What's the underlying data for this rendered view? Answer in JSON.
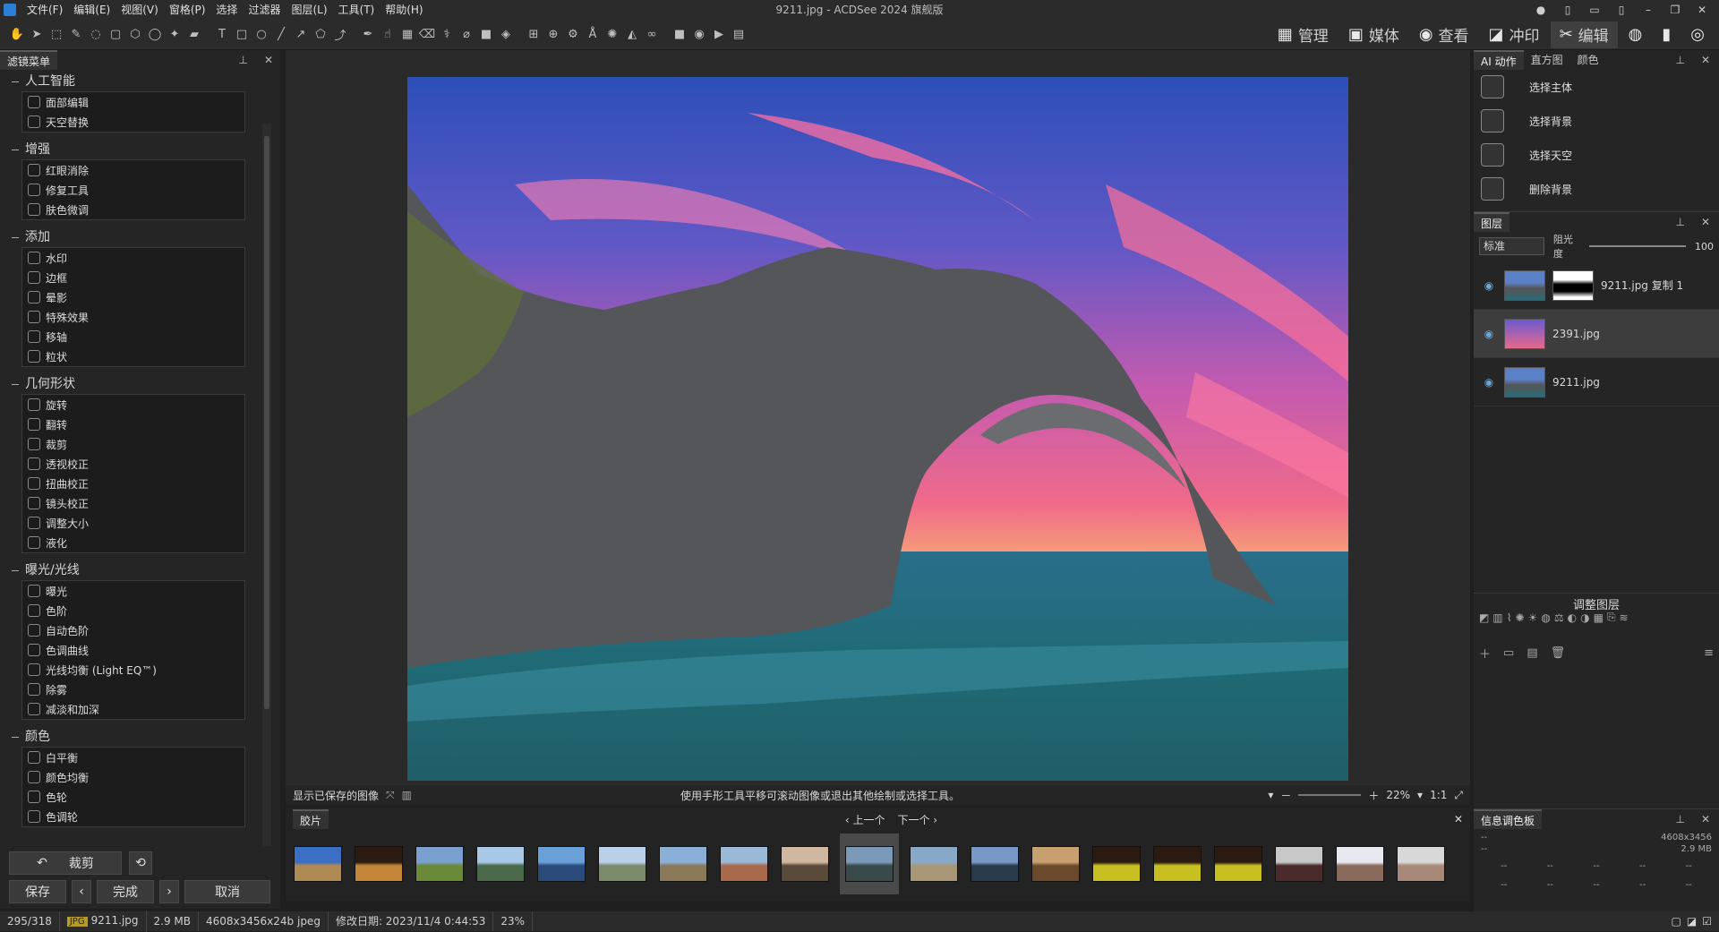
{
  "window": {
    "title": "9211.jpg - ACDSee 2024 旗舰版",
    "menu": [
      "文件(F)",
      "编辑(E)",
      "视图(V)",
      "窗格(P)",
      "选择",
      "过滤器",
      "图层(L)",
      "工具(T)",
      "帮助(H)"
    ]
  },
  "modes": [
    {
      "label": "管理",
      "icon": "grid-icon"
    },
    {
      "label": "媒体",
      "icon": "media-icon"
    },
    {
      "label": "查看",
      "icon": "eye-icon"
    },
    {
      "label": "冲印",
      "icon": "develop-icon"
    },
    {
      "label": "编辑",
      "icon": "edit-icon",
      "active": true
    }
  ],
  "left_panel": {
    "tab": "滤镜菜单",
    "sections": [
      {
        "title": "人工智能",
        "items": [
          "面部编辑",
          "天空替换"
        ]
      },
      {
        "title": "增强",
        "items": [
          "红眼消除",
          "修复工具",
          "肤色微调"
        ]
      },
      {
        "title": "添加",
        "items": [
          "水印",
          "边框",
          "晕影",
          "特殊效果",
          "移轴",
          "粒状"
        ]
      },
      {
        "title": "几何形状",
        "items": [
          "旋转",
          "翻转",
          "裁剪",
          "透视校正",
          "扭曲校正",
          "镜头校正",
          "调整大小",
          "液化"
        ]
      },
      {
        "title": "曝光/光线",
        "items": [
          "曝光",
          "色阶",
          "自动色阶",
          "色调曲线",
          "光线均衡 (Light EQ™)",
          "除雾",
          "减淡和加深"
        ]
      },
      {
        "title": "颜色",
        "items": [
          "白平衡",
          "颜色均衡",
          "色轮",
          "色调轮"
        ]
      }
    ],
    "footer": {
      "crop": "裁剪",
      "save": "保存",
      "done": "完成",
      "cancel": "取消"
    }
  },
  "canvas": {
    "show_saved": "显示已保存的图像",
    "hint": "使用手形工具平移可滚动图像或退出其他绘制或选择工具。",
    "zoom": "22%",
    "one_to_one": "1:1"
  },
  "filmstrip": {
    "tab": "胶片",
    "prev": "上一个",
    "next": "下一个"
  },
  "right_panel": {
    "tabs": [
      "AI 动作",
      "直方图",
      "颜色"
    ],
    "ai_actions": [
      "选择主体",
      "选择背景",
      "选择天空",
      "删除背景"
    ],
    "layers_tab": "图层",
    "blend_mode": "标准",
    "opacity_label": "阻光度",
    "opacity_value": "100",
    "layers": [
      {
        "name": "9211.jpg 复制 1",
        "selected": false
      },
      {
        "name": "2391.jpg",
        "selected": true
      },
      {
        "name": "9211.jpg",
        "selected": false
      }
    ],
    "adjust_title": "调整图层",
    "info_tab": "信息调色板",
    "info_dims": "4608x3456",
    "info_size": "2.9 MB",
    "info_placeholder": "--"
  },
  "status": {
    "count": "295/318",
    "format": "JPG",
    "file": "9211.jpg",
    "size": "2.9 MB",
    "dims": "4608x3456x24b jpeg",
    "modified": "修改日期: 2023/11/4 0:44:53",
    "zoom": "23%"
  }
}
